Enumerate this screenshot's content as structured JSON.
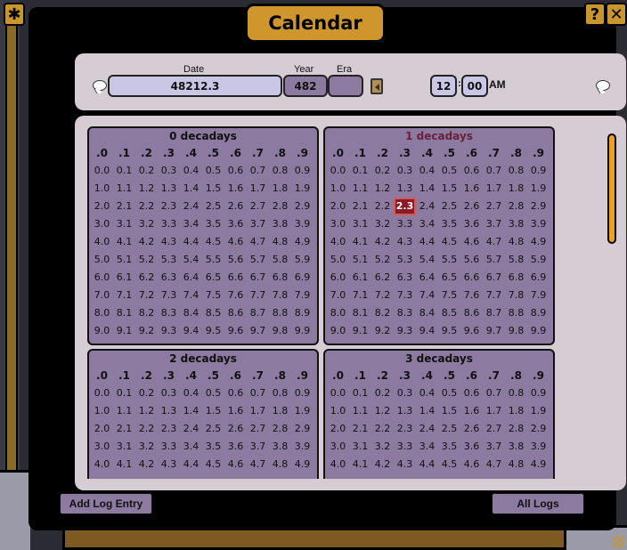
{
  "window": {
    "title": "Calendar"
  },
  "header": {
    "date_label": "Date",
    "date_value": "48212.3",
    "year_label": "Year",
    "year_value": "482",
    "era_label": "Era",
    "era_value": "",
    "hour": "12",
    "minute": "00",
    "ampm": "AM",
    "time_separator": ":"
  },
  "calendar": {
    "columns": [
      ".0",
      ".1",
      ".2",
      ".3",
      ".4",
      ".5",
      ".6",
      ".7",
      ".8",
      ".9"
    ],
    "selected_day": "2.3",
    "decadays": [
      {
        "title": "0 decadays",
        "current": false,
        "rows_visible": 10
      },
      {
        "title": "1 decadays",
        "current": true,
        "rows_visible": 10
      },
      {
        "title": "2 decadays",
        "current": false,
        "rows_visible": 5
      },
      {
        "title": "3 decadays",
        "current": false,
        "rows_visible": 5
      }
    ]
  },
  "footer": {
    "add_log_label": "Add Log Entry",
    "all_logs_label": "All Logs"
  },
  "icons": {
    "close": "close-x-icon",
    "help": "question-mark-icon",
    "comment": "speech-bubble-icon",
    "era_toggle": "arrow-toggle-icon",
    "resize": "resize-grip-icon"
  },
  "colors": {
    "accent": "#d0962e",
    "panel": "#d5cdd3",
    "decaday_bg": "#8c7aa0",
    "selected_bg": "#8b1a24",
    "current_title": "#6a2038",
    "scroll_thumb": "#f0a020"
  }
}
